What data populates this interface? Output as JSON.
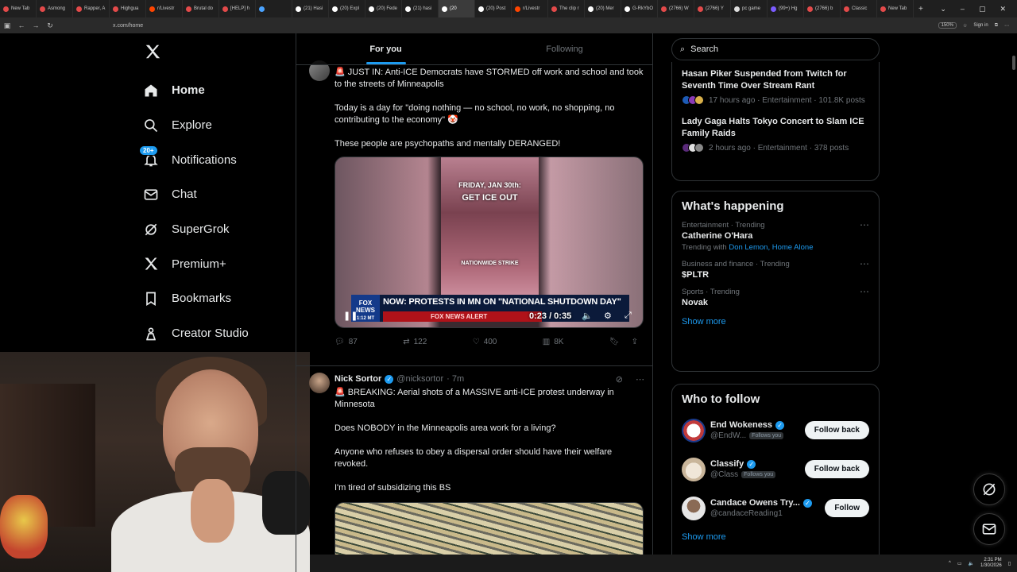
{
  "browser": {
    "tabs": [
      {
        "label": "New Tab",
        "color": "#e34a4a"
      },
      {
        "label": "Asmong",
        "color": "#e34a4a"
      },
      {
        "label": "Rapper, A",
        "color": "#e34a4a"
      },
      {
        "label": "Highgua",
        "color": "#e34a4a"
      },
      {
        "label": "r/Livestr",
        "color": "#ff4500"
      },
      {
        "label": "Brutal do",
        "color": "#e34a4a"
      },
      {
        "label": "[HELP] h",
        "color": "#e34a4a"
      },
      {
        "label": "",
        "color": "#4aa3ff"
      },
      {
        "label": "(21) Hasi",
        "color": "#ffffff"
      },
      {
        "label": "(20) Expl",
        "color": "#ffffff"
      },
      {
        "label": "(20) Fede",
        "color": "#ffffff"
      },
      {
        "label": "(21) hasi",
        "color": "#ffffff"
      },
      {
        "label": "(20",
        "color": "#ffffff"
      },
      {
        "label": "(20) Post",
        "color": "#ffffff"
      },
      {
        "label": "r/Livestr",
        "color": "#ff4500"
      },
      {
        "label": "The clip r",
        "color": "#e34a4a"
      },
      {
        "label": "(20) Mer",
        "color": "#ffffff"
      },
      {
        "label": "G-RkYbO",
        "color": "#ffffff"
      },
      {
        "label": "(2766) W",
        "color": "#e34a4a"
      },
      {
        "label": "(2766) Y",
        "color": "#e34a4a"
      },
      {
        "label": "pc game",
        "color": "#dddddd"
      },
      {
        "label": "(99+) Hg",
        "color": "#7b5cff"
      },
      {
        "label": "(2766) b",
        "color": "#e34a4a"
      },
      {
        "label": "Classic",
        "color": "#e34a4a"
      },
      {
        "label": "New Tab",
        "color": "#e34a4a"
      }
    ],
    "url": "x.com/home",
    "zoom": "150%",
    "sign_in": "Sign in"
  },
  "nav": {
    "logo": "X",
    "items": [
      {
        "label": "Home",
        "icon": "home-icon"
      },
      {
        "label": "Explore",
        "icon": "search-icon"
      },
      {
        "label": "Notifications",
        "icon": "bell-icon",
        "badge": "20+"
      },
      {
        "label": "Chat",
        "icon": "mail-icon"
      },
      {
        "label": "SuperGrok",
        "icon": "grok-icon"
      },
      {
        "label": "Premium+",
        "icon": "x-icon"
      },
      {
        "label": "Bookmarks",
        "icon": "bookmark-icon"
      },
      {
        "label": "Creator Studio",
        "icon": "creator-icon"
      }
    ]
  },
  "feed": {
    "tabs": [
      "For you",
      "Following"
    ],
    "post1": {
      "text1": "🚨 JUST IN: Anti-ICE Democrats have STORMED off work and school and took to the streets of Minneapolis",
      "text2": "Today is a day for \"doing nothing — no school, no work, no shopping, no contributing to the economy\" 🤡",
      "text3": "These people are psychopaths and mentally DERANGED!",
      "video": {
        "top_text": "FRIDAY, JAN 30th:",
        "big_text": "GET ICE OUT",
        "strike_text": "NATIONWIDE STRIKE",
        "network": "FOX NEWS",
        "time_small": "1:12 MT",
        "headline": "NOW: PROTESTS IN MN ON \"NATIONAL SHUTDOWN DAY\"",
        "alert": "FOX NEWS ALERT",
        "time": "0:23 / 0:35"
      },
      "replies": "87",
      "reposts": "122",
      "likes": "400",
      "views": "8K"
    },
    "post2": {
      "name": "Nick Sortor",
      "handle": "@nicksortor",
      "time": "· 7m",
      "text1": "🚨 BREAKING: Aerial shots of a MASSIVE anti-ICE protest underway in Minnesota",
      "text2": "Does NOBODY in the Minneapolis area work for a living?",
      "text3": "Anyone who refuses to obey a dispersal order should have their welfare revoked.",
      "text4": "I'm tired of subsidizing this BS"
    }
  },
  "right": {
    "search_placeholder": "Search",
    "news": [
      {
        "title": "Hasan Piker Suspended from Twitch for Seventh Time Over Stream Rant",
        "meta": "17 hours ago · Entertainment · 101.8K posts"
      },
      {
        "title": "Lady Gaga Halts Tokyo Concert to Slam ICE Family Raids",
        "meta": "2 hours ago · Entertainment · 378 posts"
      }
    ],
    "happening": {
      "title": "What's happening",
      "trends": [
        {
          "context": "Entertainment · Trending",
          "name": "Catherine O'Hara",
          "with_label": "Trending with",
          "with_links": "Don Lemon, Home Alone"
        },
        {
          "context": "Business and finance · Trending",
          "name": "$PLTR"
        },
        {
          "context": "Sports · Trending",
          "name": "Novak"
        }
      ],
      "show_more": "Show more"
    },
    "who_to_follow": {
      "title": "Who to follow",
      "accounts": [
        {
          "name": "End Wokeness",
          "handle": "@EndW...",
          "follows_you": "Follows you",
          "button": "Follow back"
        },
        {
          "name": "Classify",
          "handle": "@Class",
          "follows_you": "Follows you",
          "button": "Follow back"
        },
        {
          "name": "Candace Owens Try...",
          "handle": "@candaceReading1",
          "follows_you": "",
          "button": "Follow"
        }
      ],
      "show_more": "Show more"
    }
  },
  "taskbar": {
    "time": "2:31 PM",
    "date": "1/30/2026"
  },
  "colors": {
    "accent": "#1d9bf0",
    "background": "#000000",
    "border": "#2f3336"
  }
}
